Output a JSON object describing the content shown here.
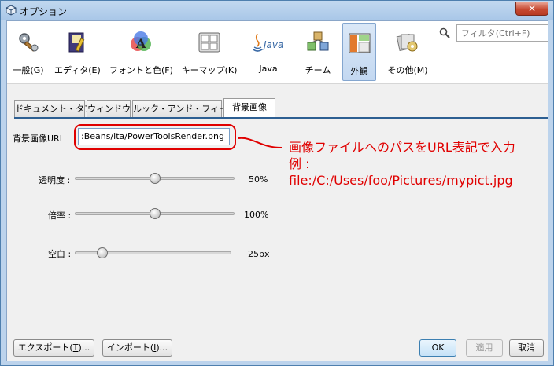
{
  "window": {
    "title": "オプション",
    "close_glyph": "✕"
  },
  "categories": [
    {
      "id": "general",
      "label": "一般(G)",
      "icon": "wrench-gear-icon"
    },
    {
      "id": "editor",
      "label": "エディタ(E)",
      "icon": "editor-book-icon"
    },
    {
      "id": "fonts",
      "label": "フォントと色(F)",
      "icon": "font-color-icon"
    },
    {
      "id": "keymap",
      "label": "キーマップ(K)",
      "icon": "keyboard-icon"
    },
    {
      "id": "java",
      "label": "Java",
      "icon": "java-logo-icon",
      "logo_text": "Java"
    },
    {
      "id": "team",
      "label": "チーム",
      "icon": "team-cubes-icon"
    },
    {
      "id": "appearance",
      "label": "外観",
      "icon": "appearance-layout-icon",
      "selected": true
    },
    {
      "id": "misc",
      "label": "その他(M)",
      "icon": "misc-cards-icon"
    }
  ],
  "search": {
    "placeholder": "フィルタ(Ctrl+F)",
    "icon": "search-icon"
  },
  "tabs": [
    {
      "label": "ドキュメント・タブ"
    },
    {
      "label": "ウィンドウ"
    },
    {
      "label": "ルック・アンド・フィール"
    },
    {
      "label": "背景画像",
      "active": true
    }
  ],
  "form": {
    "uri_label": "背景画像URI",
    "uri_value": ":Beans/ita/PowerToolsRender.png",
    "sliders": [
      {
        "label": "透明度 :",
        "value_text": "50%",
        "fraction": 0.5
      },
      {
        "label": "倍率 :",
        "value_text": "100%",
        "fraction": 0.5
      },
      {
        "label": "空白 :",
        "value_text": "25px",
        "fraction": 0.15
      }
    ]
  },
  "annotation": {
    "line1": "画像ファイルへのパスをURL表記で入力",
    "line2": "例 :",
    "line3": "file:/C:/Uses/foo/Pictures/mypict.jpg",
    "color": "#e00000"
  },
  "buttons": {
    "export_pre": "エクスポート(",
    "export_key": "T",
    "export_post": ")...",
    "import_pre": "インポート(",
    "import_key": "I",
    "import_post": ")...",
    "ok": "OK",
    "apply": "適用",
    "cancel": "取消"
  }
}
